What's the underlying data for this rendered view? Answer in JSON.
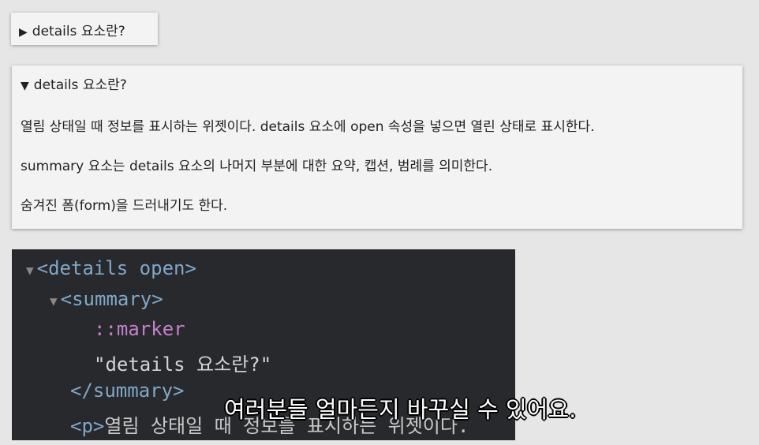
{
  "closed_details": {
    "marker": "▶",
    "summary": "details 요소란?"
  },
  "open_details": {
    "marker": "▼",
    "summary": "details 요소란?",
    "paragraphs": [
      "열림 상태일 때 정보를 표시하는 위젯이다. details 요소에 open 속성을 넣으면 열린 상태로 표시한다.",
      "summary 요소는 details 요소의 나머지 부분에 대한 요약, 캡션, 범례를 의미한다.",
      "숨겨진 폼(form)을 드러내기도 한다."
    ]
  },
  "devtools": {
    "lines": {
      "details_open": "<details open>",
      "summary_open": "<summary>",
      "marker": "::marker",
      "summary_text": "\"details 요소란?\"",
      "summary_close": "</summary>",
      "p_tag": "<p>",
      "p_text": "열림 상태일 때 정보를 표시하는 위젯이다."
    },
    "arrow": "▼"
  },
  "subtitle": "여러분들 얼마든지 바꾸실 수 있어요."
}
